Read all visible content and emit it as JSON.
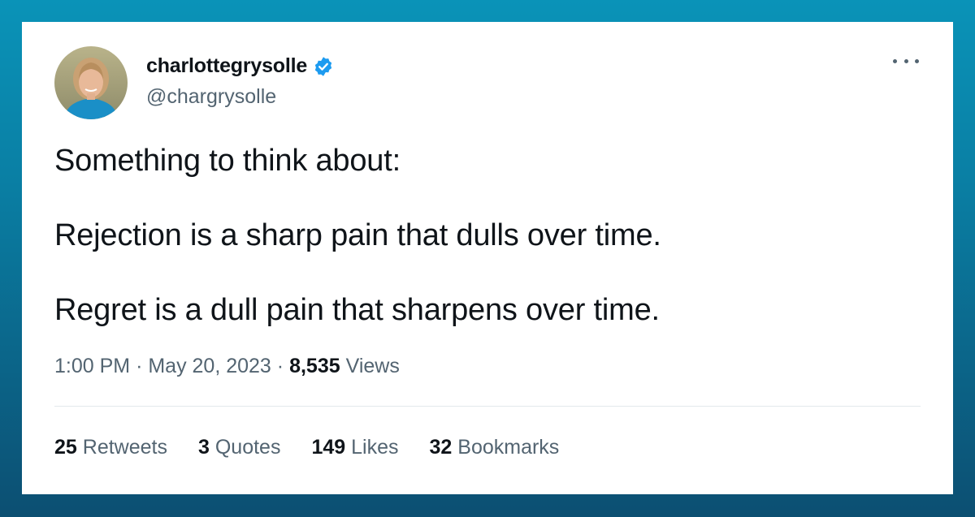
{
  "user": {
    "display_name": "charlottegrysolle",
    "handle": "@chargrysolle",
    "verified": true
  },
  "tweet": {
    "lines": [
      "Something to think about:",
      "Rejection is a sharp pain that dulls over time.",
      "Regret is a dull pain that sharpens over time."
    ],
    "time": "1:00 PM",
    "separator": "·",
    "date": "May 20, 2023",
    "views_count": "8,535",
    "views_label": "Views"
  },
  "stats": [
    {
      "count": "25",
      "label": "Retweets"
    },
    {
      "count": "3",
      "label": "Quotes"
    },
    {
      "count": "149",
      "label": "Likes"
    },
    {
      "count": "32",
      "label": "Bookmarks"
    }
  ],
  "icons": {
    "verified": "verified-badge-icon",
    "more": "more-options-icon"
  },
  "colors": {
    "verified_blue": "#1d9bf0",
    "text_primary": "#0f1419",
    "text_secondary": "#536471",
    "background_top": "#0a93b8",
    "background_bottom": "#0c4f72"
  }
}
